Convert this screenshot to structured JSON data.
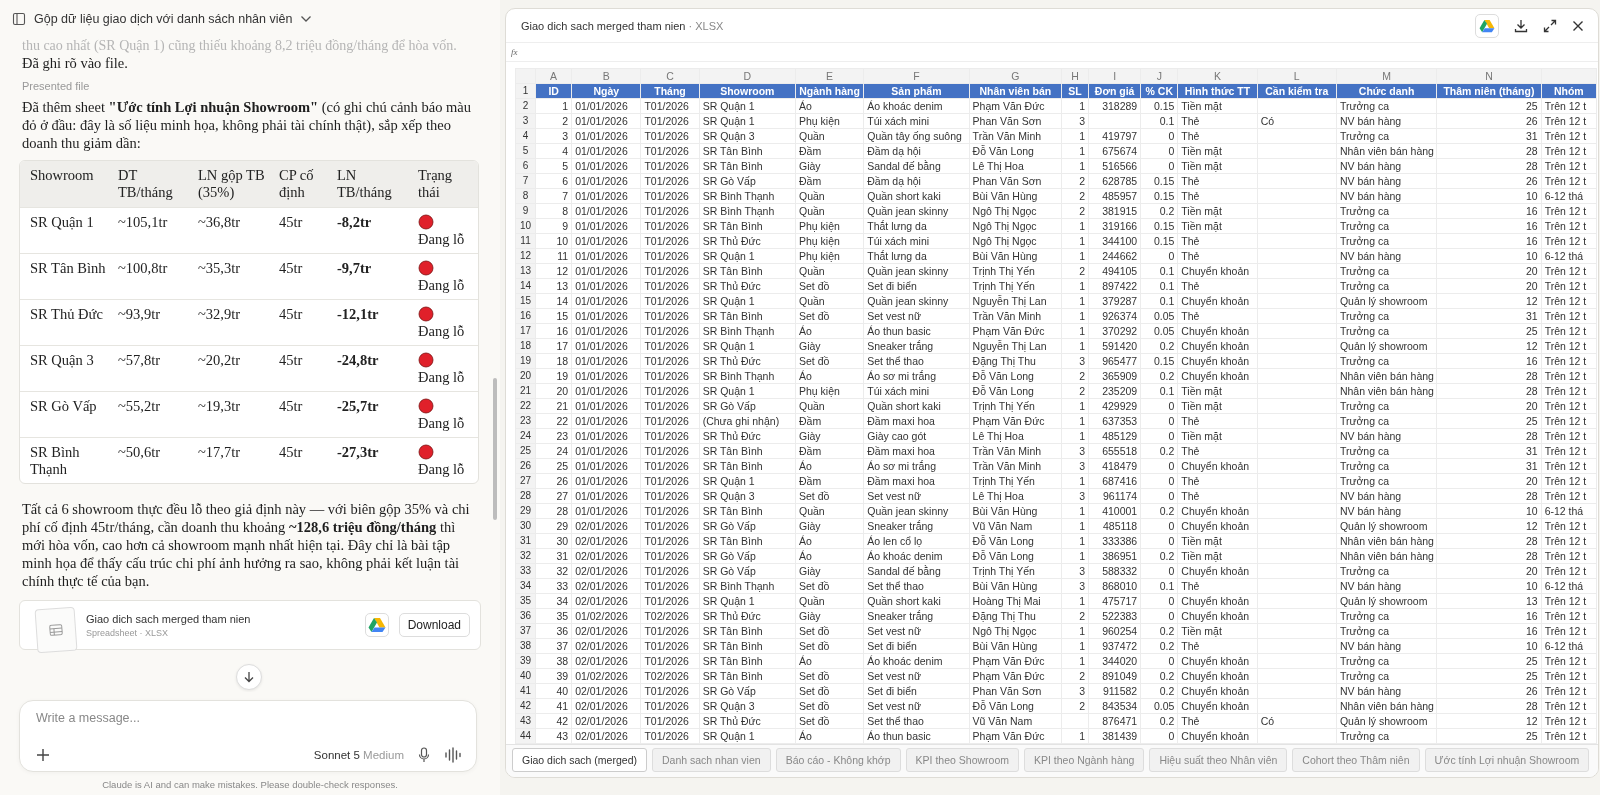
{
  "conversation": {
    "title": "Gộp dữ liệu giao dịch với danh sách nhân viên",
    "previous_tail": "thu cao nhất (SR Quận 1) cũng thiếu khoảng 8,2 triệu đồng/tháng để hòa vốn.",
    "previous_end": "Đã ghi rõ vào file.",
    "presented_label": "Presented file",
    "intro": "Đã thêm sheet **\"Ước tính Lợi nhuận Showroom\"** (có ghi chú cảnh báo màu đỏ ở đầu: đây là số liệu minh họa, không phải tài chính thật), sắp xếp theo doanh thu giảm dần:",
    "table": {
      "columns": [
        "Showroom",
        "DT TB/tháng",
        "LN gộp TB (35%)",
        "CP cố định",
        "LN TB/tháng",
        "Trạng thái"
      ],
      "rows": [
        [
          "SR Quận 1",
          "~105,1tr",
          "~36,8tr",
          "45tr",
          "-8,2tr",
          "Đang lỗ"
        ],
        [
          "SR Tân Bình",
          "~100,8tr",
          "~35,3tr",
          "45tr",
          "-9,7tr",
          "Đang lỗ"
        ],
        [
          "SR Thủ Đức",
          "~93,9tr",
          "~32,9tr",
          "45tr",
          "-12,1tr",
          "Đang lỗ"
        ],
        [
          "SR Quận 3",
          "~57,8tr",
          "~20,2tr",
          "45tr",
          "-24,8tr",
          "Đang lỗ"
        ],
        [
          "SR Gò Vấp",
          "~55,2tr",
          "~19,3tr",
          "45tr",
          "-25,7tr",
          "Đang lỗ"
        ],
        [
          "SR Bình Thạnh",
          "~50,6tr",
          "~17,7tr",
          "45tr",
          "-27,3tr",
          "Đang lỗ"
        ]
      ]
    },
    "summary": "Tất cả 6 showroom thực đều lỗ theo giả định này — với biên gộp 35% và chi phí cố định 45tr/tháng, cần doanh thu khoảng **~128,6 triệu đồng/tháng** thì mới hòa vốn, cao hơn cả showroom mạnh nhất hiện tại. Đây chỉ là bài tập minh họa để thấy cấu trúc chi phí ảnh hưởng ra sao, không phải kết luận tài chính thực tế của bạn.",
    "file_card": {
      "name": "Giao dich sach merged tham nien",
      "meta": "Spreadsheet · XLSX",
      "button": "Download"
    }
  },
  "composer": {
    "placeholder": "Write a message...",
    "model": "Sonnet 5",
    "effort": "Medium"
  },
  "disclaimer": "Claude is AI and can make mistakes. Please double-check responses.",
  "viewer": {
    "title": "Giao dich sach merged tham nien",
    "format": "· XLSX",
    "formula_label": "fx",
    "column_letters": [
      "A",
      "B",
      "C",
      "D",
      "E",
      "F",
      "G",
      "H",
      "I",
      "J",
      "K",
      "L",
      "M",
      "N"
    ],
    "header_row": {
      "number": "1",
      "cells": [
        "ID",
        "Ngày",
        "Tháng",
        "Showroom",
        "Ngành hàng",
        "Sản phẩm",
        "Nhân viên bán",
        "SL",
        "Đơn giá",
        "% CK",
        "Hình thức TT",
        "Cần kiểm tra",
        "Chức danh",
        "Thâm niên (tháng)",
        "Nhóm"
      ]
    },
    "rows": [
      {
        "number": "2",
        "cells": [
          "1",
          "01/01/2026",
          "T01/2026",
          "SR Quận 1",
          "Áo",
          "Áo khoác denim",
          "Phạm Văn Đức",
          "1",
          "318289",
          "0.15",
          "Tiền mặt",
          null,
          "Trưởng ca",
          "25",
          "Trên 12 t"
        ]
      },
      {
        "number": "3",
        "cells": [
          "2",
          "01/01/2026",
          "T01/2026",
          "SR Quận 1",
          "Phụ kiện",
          "Túi xách mini",
          "Phan Văn Sơn",
          "3",
          null,
          "0.1",
          "Thẻ",
          "Có",
          "NV bán hàng",
          "26",
          "Trên 12 t"
        ]
      },
      {
        "number": "4",
        "cells": [
          "3",
          "01/01/2026",
          "T01/2026",
          "SR Quận 3",
          "Quần",
          "Quần tây ống suông",
          "Trần Văn Minh",
          "1",
          "419797",
          "0",
          "Thẻ",
          null,
          "Trưởng ca",
          "31",
          "Trên 12 t"
        ]
      },
      {
        "number": "5",
        "cells": [
          "4",
          "01/01/2026",
          "T01/2026",
          "SR Tân Bình",
          "Đầm",
          "Đầm dạ hội",
          "Đỗ Văn Long",
          "1",
          "675674",
          "0",
          "Tiền mặt",
          null,
          "Nhân viên bán hàng",
          "28",
          "Trên 12 t"
        ]
      },
      {
        "number": "6",
        "cells": [
          "5",
          "01/01/2026",
          "T01/2026",
          "SR Tân Bình",
          "Giày",
          "Sandal đế bằng",
          "Lê Thị Hoa",
          "1",
          "516566",
          "0",
          "Tiền mặt",
          null,
          "NV bán hàng",
          "28",
          "Trên 12 t"
        ]
      },
      {
        "number": "7",
        "cells": [
          "6",
          "01/01/2026",
          "T01/2026",
          "SR Gò Vấp",
          "Đầm",
          "Đầm dạ hội",
          "Phan Văn Sơn",
          "2",
          "628785",
          "0.15",
          "Thẻ",
          null,
          "NV bán hàng",
          "26",
          "Trên 12 t"
        ]
      },
      {
        "number": "8",
        "cells": [
          "7",
          "01/01/2026",
          "T01/2026",
          "SR Bình Thạnh",
          "Quần",
          "Quần short kaki",
          "Bùi Văn Hùng",
          "2",
          "485957",
          "0.15",
          "Thẻ",
          null,
          "NV bán hàng",
          "10",
          "6-12 thá"
        ]
      },
      {
        "number": "9",
        "cells": [
          "8",
          "01/01/2026",
          "T01/2026",
          "SR Bình Thạnh",
          "Quần",
          "Quần jean skinny",
          "Ngô Thị Ngọc",
          "2",
          "381915",
          "0.2",
          "Tiền mặt",
          null,
          "Trưởng ca",
          "16",
          "Trên 12 t"
        ]
      },
      {
        "number": "10",
        "cells": [
          "9",
          "01/01/2026",
          "T01/2026",
          "SR Tân Bình",
          "Phụ kiện",
          "Thắt lưng da",
          "Ngô Thị Ngọc",
          "1",
          "319166",
          "0.15",
          "Tiền mặt",
          null,
          "Trưởng ca",
          "16",
          "Trên 12 t"
        ]
      },
      {
        "number": "11",
        "cells": [
          "10",
          "01/01/2026",
          "T01/2026",
          "SR Thủ Đức",
          "Phụ kiện",
          "Túi xách mini",
          "Ngô Thị Ngọc",
          "1",
          "344100",
          "0.15",
          "Thẻ",
          null,
          "Trưởng ca",
          "16",
          "Trên 12 t"
        ]
      },
      {
        "number": "12",
        "cells": [
          "11",
          "01/01/2026",
          "T01/2026",
          "SR Quận 1",
          "Phụ kiện",
          "Thắt lưng da",
          "Bùi Văn Hùng",
          "1",
          "244662",
          "0",
          "Thẻ",
          null,
          "NV bán hàng",
          "10",
          "6-12 thá"
        ]
      },
      {
        "number": "13",
        "cells": [
          "12",
          "01/01/2026",
          "T01/2026",
          "SR Tân Bình",
          "Quần",
          "Quần jean skinny",
          "Trịnh Thị Yến",
          "2",
          "494105",
          "0.1",
          "Chuyển khoản",
          null,
          "Trưởng ca",
          "20",
          "Trên 12 t"
        ]
      },
      {
        "number": "14",
        "cells": [
          "13",
          "01/01/2026",
          "T01/2026",
          "SR Thủ Đức",
          "Set đồ",
          "Set đi biển",
          "Trịnh Thị Yến",
          "1",
          "897422",
          "0.1",
          "Thẻ",
          null,
          "Trưởng ca",
          "20",
          "Trên 12 t"
        ]
      },
      {
        "number": "15",
        "cells": [
          "14",
          "01/01/2026",
          "T01/2026",
          "SR Quận 1",
          "Quần",
          "Quần jean skinny",
          "Nguyễn Thị Lan",
          "1",
          "379287",
          "0.1",
          "Chuyển khoản",
          null,
          "Quản lý showroom",
          "12",
          "Trên 12 t"
        ]
      },
      {
        "number": "16",
        "cells": [
          "15",
          "01/01/2026",
          "T01/2026",
          "SR Tân Bình",
          "Set đồ",
          "Set vest nữ",
          "Trần Văn Minh",
          "1",
          "926374",
          "0.05",
          "Thẻ",
          null,
          "Trưởng ca",
          "31",
          "Trên 12 t"
        ]
      },
      {
        "number": "17",
        "cells": [
          "16",
          "01/01/2026",
          "T01/2026",
          "SR Bình Thạnh",
          "Áo",
          "Áo thun basic",
          "Phạm Văn Đức",
          "1",
          "370292",
          "0.05",
          "Chuyển khoản",
          null,
          "Trưởng ca",
          "25",
          "Trên 12 t"
        ]
      },
      {
        "number": "18",
        "cells": [
          "17",
          "01/01/2026",
          "T01/2026",
          "SR Quận 1",
          "Giày",
          "Sneaker trắng",
          "Nguyễn Thị Lan",
          "1",
          "591420",
          "0.2",
          "Chuyển khoản",
          null,
          "Quản lý showroom",
          "12",
          "Trên 12 t"
        ]
      },
      {
        "number": "19",
        "cells": [
          "18",
          "01/01/2026",
          "T01/2026",
          "SR Thủ Đức",
          "Set đồ",
          "Set thể thao",
          "Đặng Thị Thu",
          "3",
          "965477",
          "0.15",
          "Chuyển khoản",
          null,
          "Trưởng ca",
          "16",
          "Trên 12 t"
        ]
      },
      {
        "number": "20",
        "cells": [
          "19",
          "01/01/2026",
          "T01/2026",
          "SR Bình Thạnh",
          "Áo",
          "Áo sơ mi trắng",
          "Đỗ Văn Long",
          "2",
          "365909",
          "0.2",
          "Chuyển khoản",
          null,
          "Nhân viên bán hàng",
          "28",
          "Trên 12 t"
        ]
      },
      {
        "number": "21",
        "cells": [
          "20",
          "01/01/2026",
          "T01/2026",
          "SR Quận 1",
          "Phụ kiện",
          "Túi xách mini",
          "Đỗ Văn Long",
          "2",
          "235209",
          "0.1",
          "Tiền mặt",
          null,
          "Nhân viên bán hàng",
          "28",
          "Trên 12 t"
        ]
      },
      {
        "number": "22",
        "cells": [
          "21",
          "01/01/2026",
          "T01/2026",
          "SR Gò Vấp",
          "Quần",
          "Quần short kaki",
          "Trịnh Thị Yến",
          "1",
          "429929",
          "0",
          "Tiền mặt",
          null,
          "Trưởng ca",
          "20",
          "Trên 12 t"
        ]
      },
      {
        "number": "23",
        "cells": [
          "22",
          "01/01/2026",
          "T01/2026",
          "(Chưa ghi nhận)",
          "Đầm",
          "Đầm maxi hoa",
          "Phạm Văn Đức",
          "1",
          "637353",
          "0",
          "Thẻ",
          null,
          "Trưởng ca",
          "25",
          "Trên 12 t"
        ]
      },
      {
        "number": "24",
        "cells": [
          "23",
          "01/01/2026",
          "T01/2026",
          "SR Thủ Đức",
          "Giày",
          "Giày cao gót",
          "Lê Thị Hoa",
          "1",
          "485129",
          "0",
          "Tiền mặt",
          null,
          "NV bán hàng",
          "28",
          "Trên 12 t"
        ]
      },
      {
        "number": "25",
        "cells": [
          "24",
          "01/01/2026",
          "T01/2026",
          "SR Tân Bình",
          "Đầm",
          "Đầm maxi hoa",
          "Trần Văn Minh",
          "3",
          "655518",
          "0.2",
          "Thẻ",
          null,
          "Trưởng ca",
          "31",
          "Trên 12 t"
        ]
      },
      {
        "number": "26",
        "cells": [
          "25",
          "01/01/2026",
          "T01/2026",
          "SR Tân Bình",
          "Áo",
          "Áo sơ mi trắng",
          "Trần Văn Minh",
          "3",
          "418479",
          "0",
          "Chuyển khoản",
          null,
          "Trưởng ca",
          "31",
          "Trên 12 t"
        ]
      },
      {
        "number": "27",
        "cells": [
          "26",
          "01/01/2026",
          "T01/2026",
          "SR Quận 1",
          "Đầm",
          "Đầm maxi hoa",
          "Trịnh Thị Yến",
          "1",
          "687416",
          "0",
          "Thẻ",
          null,
          "Trưởng ca",
          "20",
          "Trên 12 t"
        ]
      },
      {
        "number": "28",
        "cells": [
          "27",
          "01/01/2026",
          "T01/2026",
          "SR Quận 3",
          "Set đồ",
          "Set vest nữ",
          "Lê Thị Hoa",
          "3",
          "961174",
          "0",
          "Thẻ",
          null,
          "NV bán hàng",
          "28",
          "Trên 12 t"
        ]
      },
      {
        "number": "29",
        "cells": [
          "28",
          "01/01/2026",
          "T01/2026",
          "SR Tân Bình",
          "Quần",
          "Quần jean skinny",
          "Bùi Văn Hùng",
          "1",
          "410001",
          "0.2",
          "Chuyển khoản",
          null,
          "NV bán hàng",
          "10",
          "6-12 thá"
        ]
      },
      {
        "number": "30",
        "cells": [
          "29",
          "02/01/2026",
          "T01/2026",
          "SR Gò Vấp",
          "Giày",
          "Sneaker trắng",
          "Vũ Văn Nam",
          "1",
          "485118",
          "0",
          "Chuyển khoản",
          null,
          "Quản lý showroom",
          "12",
          "Trên 12 t"
        ]
      },
      {
        "number": "31",
        "cells": [
          "30",
          "02/01/2026",
          "T01/2026",
          "SR Tân Bình",
          "Áo",
          "Áo len cổ lọ",
          "Đỗ Văn Long",
          "1",
          "333386",
          "0",
          "Tiền mặt",
          null,
          "Nhân viên bán hàng",
          "28",
          "Trên 12 t"
        ]
      },
      {
        "number": "32",
        "cells": [
          "31",
          "02/01/2026",
          "T01/2026",
          "SR Gò Vấp",
          "Áo",
          "Áo khoác denim",
          "Đỗ Văn Long",
          "1",
          "386951",
          "0.2",
          "Tiền mặt",
          null,
          "Nhân viên bán hàng",
          "28",
          "Trên 12 t"
        ]
      },
      {
        "number": "33",
        "cells": [
          "32",
          "02/01/2026",
          "T01/2026",
          "SR Gò Vấp",
          "Giày",
          "Sandal đế bằng",
          "Trịnh Thị Yến",
          "3",
          "588332",
          "0",
          "Chuyển khoản",
          null,
          "Trưởng ca",
          "20",
          "Trên 12 t"
        ]
      },
      {
        "number": "34",
        "cells": [
          "33",
          "02/01/2026",
          "T01/2026",
          "SR Bình Thạnh",
          "Set đồ",
          "Set thể thao",
          "Bùi Văn Hùng",
          "3",
          "868010",
          "0.1",
          "Thẻ",
          null,
          "NV bán hàng",
          "10",
          "6-12 thá"
        ]
      },
      {
        "number": "35",
        "cells": [
          "34",
          "02/01/2026",
          "T01/2026",
          "SR Quận 1",
          "Quần",
          "Quần short kaki",
          "Hoàng Thị Mai",
          "1",
          "475717",
          "0",
          "Chuyển khoản",
          null,
          "Quản lý showroom",
          "13",
          "Trên 12 t"
        ]
      },
      {
        "number": "36",
        "cells": [
          "35",
          "01/02/2026",
          "T02/2026",
          "SR Thủ Đức",
          "Giày",
          "Sneaker trắng",
          "Đặng Thị Thu",
          "2",
          "522383",
          "0",
          "Chuyển khoản",
          null,
          "Trưởng ca",
          "16",
          "Trên 12 t"
        ]
      },
      {
        "number": "37",
        "cells": [
          "36",
          "02/01/2026",
          "T01/2026",
          "SR Tân Bình",
          "Set đồ",
          "Set vest nữ",
          "Ngô Thị Ngọc",
          "1",
          "960254",
          "0.2",
          "Tiền mặt",
          null,
          "Trưởng ca",
          "16",
          "Trên 12 t"
        ]
      },
      {
        "number": "38",
        "cells": [
          "37",
          "02/01/2026",
          "T01/2026",
          "SR Tân Bình",
          "Set đồ",
          "Set đi biển",
          "Bùi Văn Hùng",
          "1",
          "937472",
          "0.2",
          "Thẻ",
          null,
          "NV bán hàng",
          "10",
          "6-12 thá"
        ]
      },
      {
        "number": "39",
        "cells": [
          "38",
          "02/01/2026",
          "T01/2026",
          "SR Tân Bình",
          "Áo",
          "Áo khoác denim",
          "Phạm Văn Đức",
          "1",
          "344020",
          "0",
          "Chuyển khoản",
          null,
          "Trưởng ca",
          "25",
          "Trên 12 t"
        ]
      },
      {
        "number": "40",
        "cells": [
          "39",
          "01/02/2026",
          "T02/2026",
          "SR Tân Bình",
          "Set đồ",
          "Set vest nữ",
          "Phạm Văn Đức",
          "2",
          "891049",
          "0.2",
          "Chuyển khoản",
          null,
          "Trưởng ca",
          "25",
          "Trên 12 t"
        ]
      },
      {
        "number": "41",
        "cells": [
          "40",
          "02/01/2026",
          "T01/2026",
          "SR Gò Vấp",
          "Set đồ",
          "Set đi biển",
          "Phan Văn Sơn",
          "3",
          "911582",
          "0.2",
          "Chuyển khoản",
          null,
          "NV bán hàng",
          "26",
          "Trên 12 t"
        ]
      },
      {
        "number": "42",
        "cells": [
          "41",
          "02/01/2026",
          "T01/2026",
          "SR Quận 3",
          "Set đồ",
          "Set vest nữ",
          "Đỗ Văn Long",
          "2",
          "843534",
          "0.05",
          "Chuyển khoản",
          null,
          "Nhân viên bán hàng",
          "28",
          "Trên 12 t"
        ]
      },
      {
        "number": "43",
        "cells": [
          "42",
          "02/01/2026",
          "T01/2026",
          "SR Thủ Đức",
          "Set đồ",
          "Set thể thao",
          "Vũ Văn Nam",
          null,
          "876471",
          "0.2",
          "Thẻ",
          "Có",
          "Quản lý showroom",
          "12",
          "Trên 12 t"
        ]
      },
      {
        "number": "44",
        "cells": [
          "43",
          "02/01/2026",
          "T01/2026",
          "SR Quận 1",
          "Áo",
          "Áo thun basic",
          "Phạm Văn Đức",
          "1",
          "381439",
          "0",
          "Chuyển khoản",
          null,
          "Trưởng ca",
          "25",
          "Trên 12 t"
        ]
      }
    ],
    "tabs": [
      {
        "label": "Giao dich sach (merged)",
        "selected": true
      },
      {
        "label": "Danh sach nhan vien",
        "selected": false
      },
      {
        "label": "Báo cáo - Không khớp",
        "selected": false
      },
      {
        "label": "KPI theo Showroom",
        "selected": false
      },
      {
        "label": "KPI theo Ngành hàng",
        "selected": false
      },
      {
        "label": "Hiệu suất theo Nhân viên",
        "selected": false
      },
      {
        "label": "Cohort theo Thâm niên",
        "selected": false
      },
      {
        "label": "Ước tính Lợi nhuận Showroom",
        "selected": false
      }
    ]
  }
}
